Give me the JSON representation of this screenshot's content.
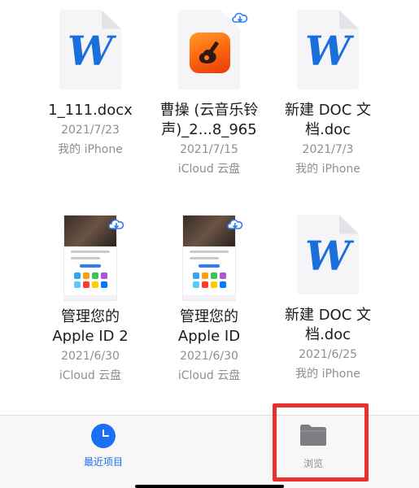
{
  "files": [
    {
      "kind": "word",
      "icon": "word-doc-icon",
      "name_lines": [
        "1_111.docx"
      ],
      "date": "2021/7/23",
      "location": "我的 iPhone",
      "cloud": false
    },
    {
      "kind": "audio",
      "icon": "garageband-icon",
      "name_lines": [
        "曹操 (云音乐铃",
        "声)_2...8_965"
      ],
      "date": "2021/7/15",
      "location": "iCloud 云盘",
      "cloud": true
    },
    {
      "kind": "word",
      "icon": "word-doc-icon",
      "name_lines": [
        "新建 DOC 文",
        "档.doc"
      ],
      "date": "2021/7/3",
      "location": "我的 iPhone",
      "cloud": false
    },
    {
      "kind": "shot",
      "icon": "screenshot-thumbnail",
      "name_lines": [
        "管理您的",
        "Apple ID 2"
      ],
      "date": "2021/6/30",
      "location": "iCloud 云盘",
      "cloud": true
    },
    {
      "kind": "shot",
      "icon": "screenshot-thumbnail",
      "name_lines": [
        "管理您的",
        "Apple ID"
      ],
      "date": "2021/6/30",
      "location": "iCloud 云盘",
      "cloud": true
    },
    {
      "kind": "word",
      "icon": "word-doc-icon",
      "name_lines": [
        "新建 DOC 文",
        "档.doc"
      ],
      "date": "2021/6/25",
      "location": "我的 iPhone",
      "cloud": false
    }
  ],
  "tabbar": {
    "recent": {
      "label": "最近项目",
      "icon": "clock-icon",
      "active": true
    },
    "browse": {
      "label": "浏览",
      "icon": "folder-icon",
      "active": false
    }
  },
  "colors": {
    "accent": "#1a6ff4",
    "word_blue": "#1b6fdc",
    "highlight": "#e8312f",
    "meta_gray": "#8e8e93"
  },
  "word_letter": "W"
}
